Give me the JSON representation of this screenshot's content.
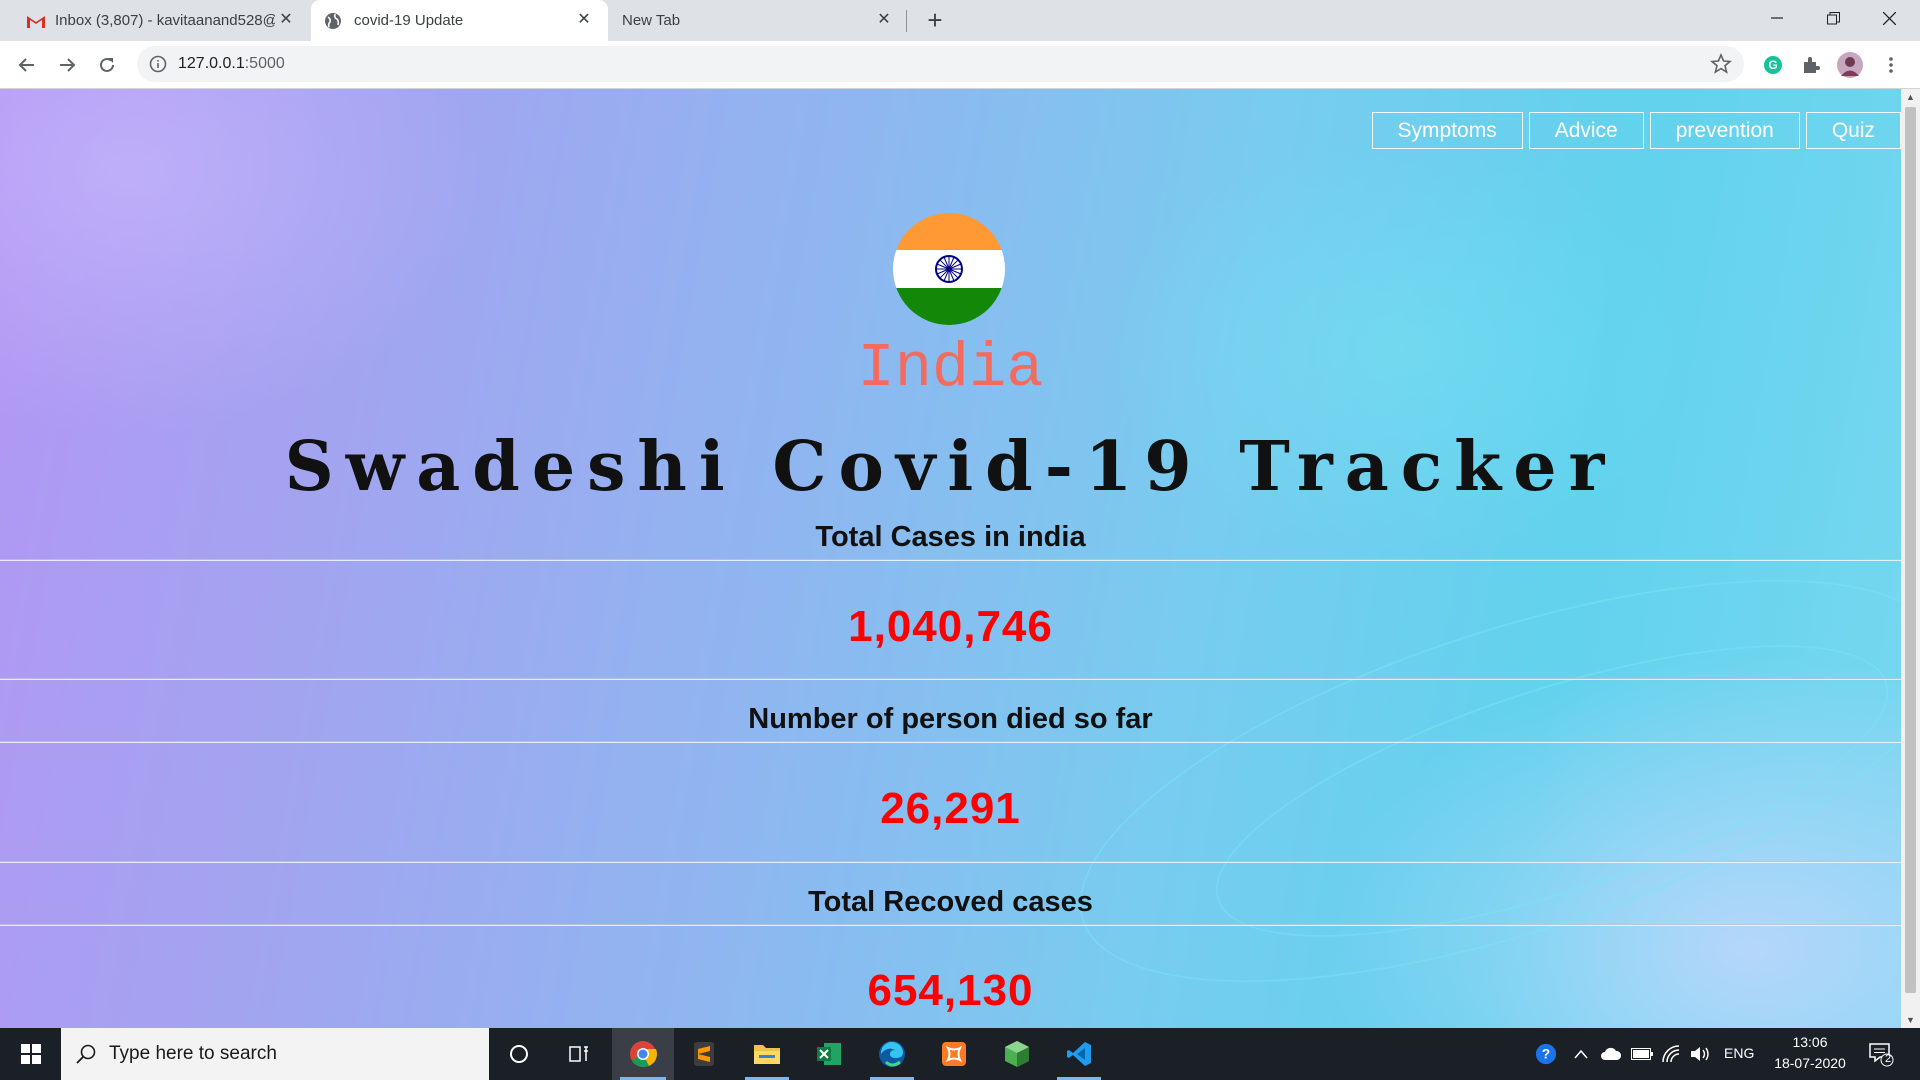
{
  "browser": {
    "tabs": [
      {
        "title": "Inbox (3,807) - kavitaanand528@",
        "icon": "gmail-icon",
        "active": false
      },
      {
        "title": "covid-19 Update",
        "icon": "globe-icon",
        "active": true
      },
      {
        "title": "New Tab",
        "icon": "",
        "active": false
      }
    ],
    "url_host": "127.0.0.1",
    "url_port": ":5000"
  },
  "page": {
    "nav": [
      "Symptoms",
      "Advice",
      "prevention",
      "Quiz"
    ],
    "country": "India",
    "title": "Swadeshi Covid-19 Tracker",
    "stats": [
      {
        "label": "Total Cases in india",
        "value": "1,040,746"
      },
      {
        "label": "Number of person died so far",
        "value": "26,291"
      },
      {
        "label": "Total Recoved cases",
        "value": "654,130"
      }
    ],
    "colors": {
      "value_color": "#ff0000",
      "country_color": "#f26b5e",
      "flag_saffron": "#ff9933",
      "flag_green": "#138808",
      "chakra": "#000080"
    }
  },
  "taskbar": {
    "search_placeholder": "Type here to search",
    "apps": [
      "cortana-icon",
      "task-view-icon",
      "chrome-icon",
      "sublime-text-icon",
      "file-explorer-icon",
      "excel-icon",
      "edge-icon",
      "xampp-icon",
      "cube-app-icon",
      "vscode-icon"
    ],
    "language": "ENG",
    "time": "13:06",
    "date": "18-07-2020",
    "notification_count": "2"
  }
}
